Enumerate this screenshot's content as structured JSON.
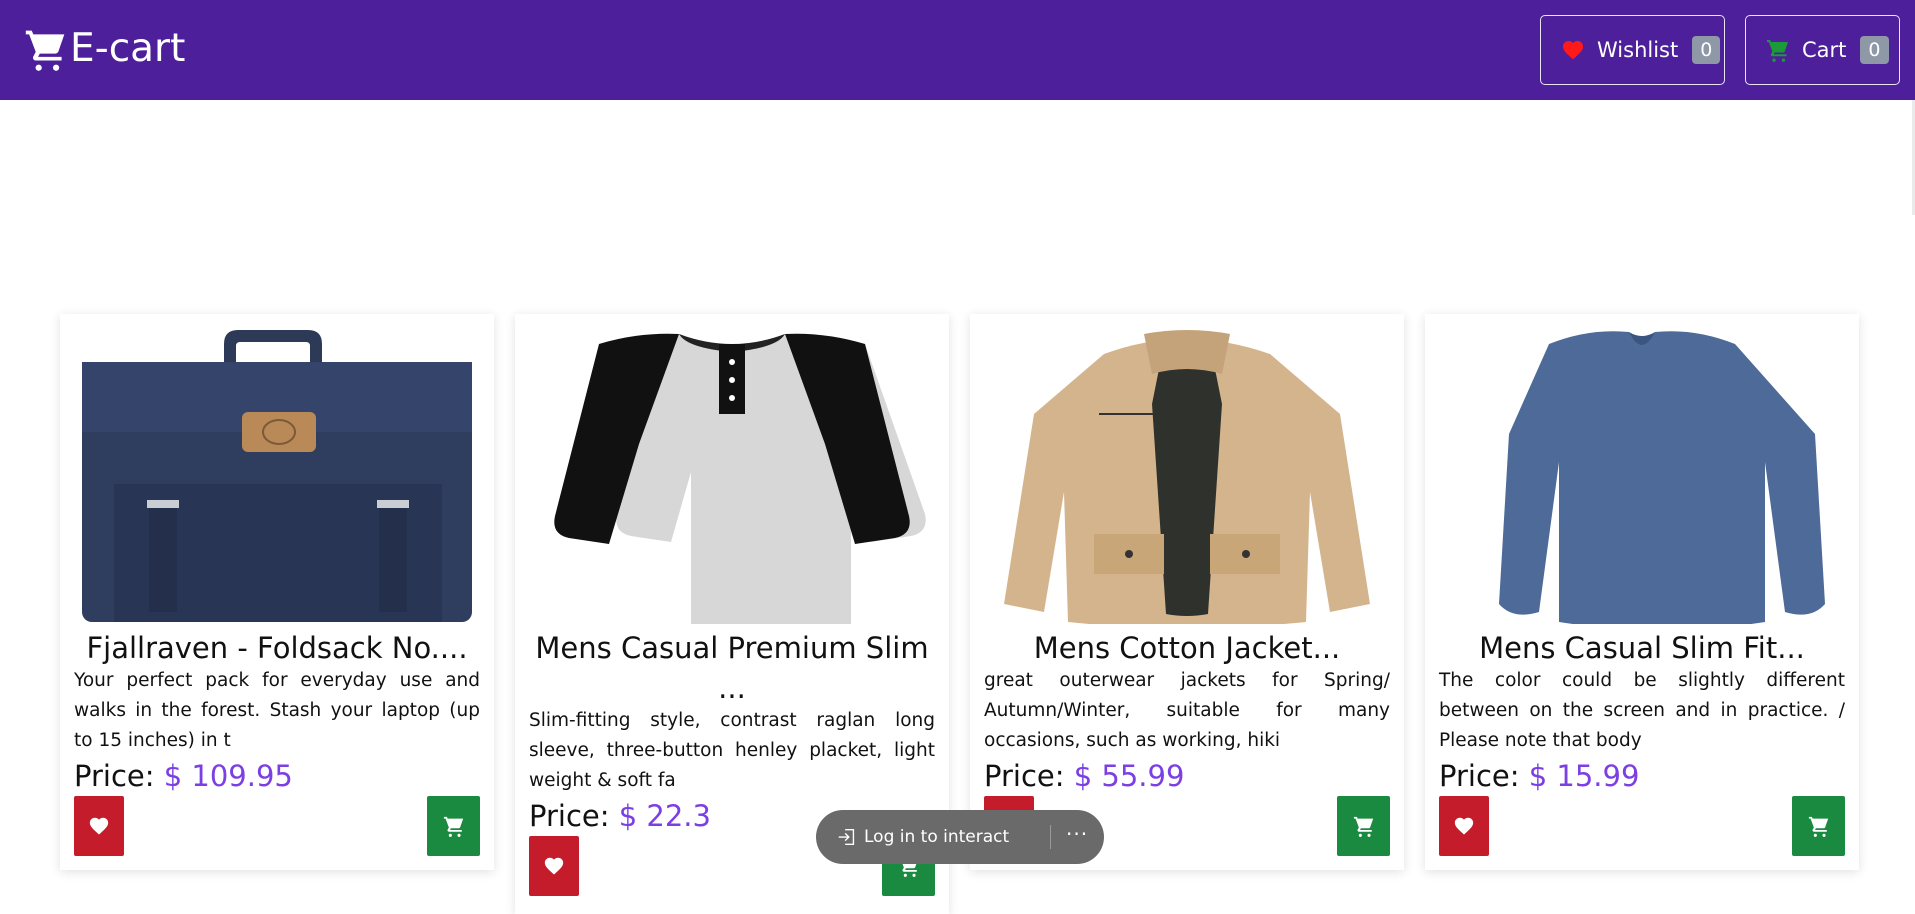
{
  "header": {
    "brand": "E-cart",
    "wishlist_label": "Wishlist",
    "wishlist_count": "0",
    "cart_label": "Cart",
    "cart_count": "0"
  },
  "products": [
    {
      "title": "Fjallraven - Foldsack No....",
      "description": "Your perfect pack for everyday use and walks in the forest. Stash your laptop (up to 15 inches) in t",
      "price_label": "Price:",
      "price_value": "$ 109.95",
      "image": "navy-backpack"
    },
    {
      "title": "Mens Casual Premium Slim ...",
      "description": "Slim-fitting style, contrast raglan long sleeve, three-button henley placket, light weight & soft fa",
      "price_label": "Price:",
      "price_value": "$ 22.3",
      "image": "raglan-henley-shirt"
    },
    {
      "title": "Mens Cotton Jacket...",
      "description": "great outerwear jackets for Spring/ Autumn/Winter, suitable for many occasions, such as working, hiki",
      "price_label": "Price:",
      "price_value": "$ 55.99",
      "image": "khaki-cotton-jacket"
    },
    {
      "title": "Mens Casual Slim Fit...",
      "description": "The color could be slightly different between on the screen and in practice. / Please note that body",
      "price_label": "Price:",
      "price_value": "$ 15.99",
      "image": "blue-long-sleeve-tee"
    }
  ],
  "overlay": {
    "login_text": "Log in to interact",
    "more_text": "···"
  },
  "colors": {
    "navbar": "#4e1f9b",
    "price": "#7b3fe4",
    "wishlist_button": "#c41c2b",
    "cart_button": "#198a3f"
  }
}
